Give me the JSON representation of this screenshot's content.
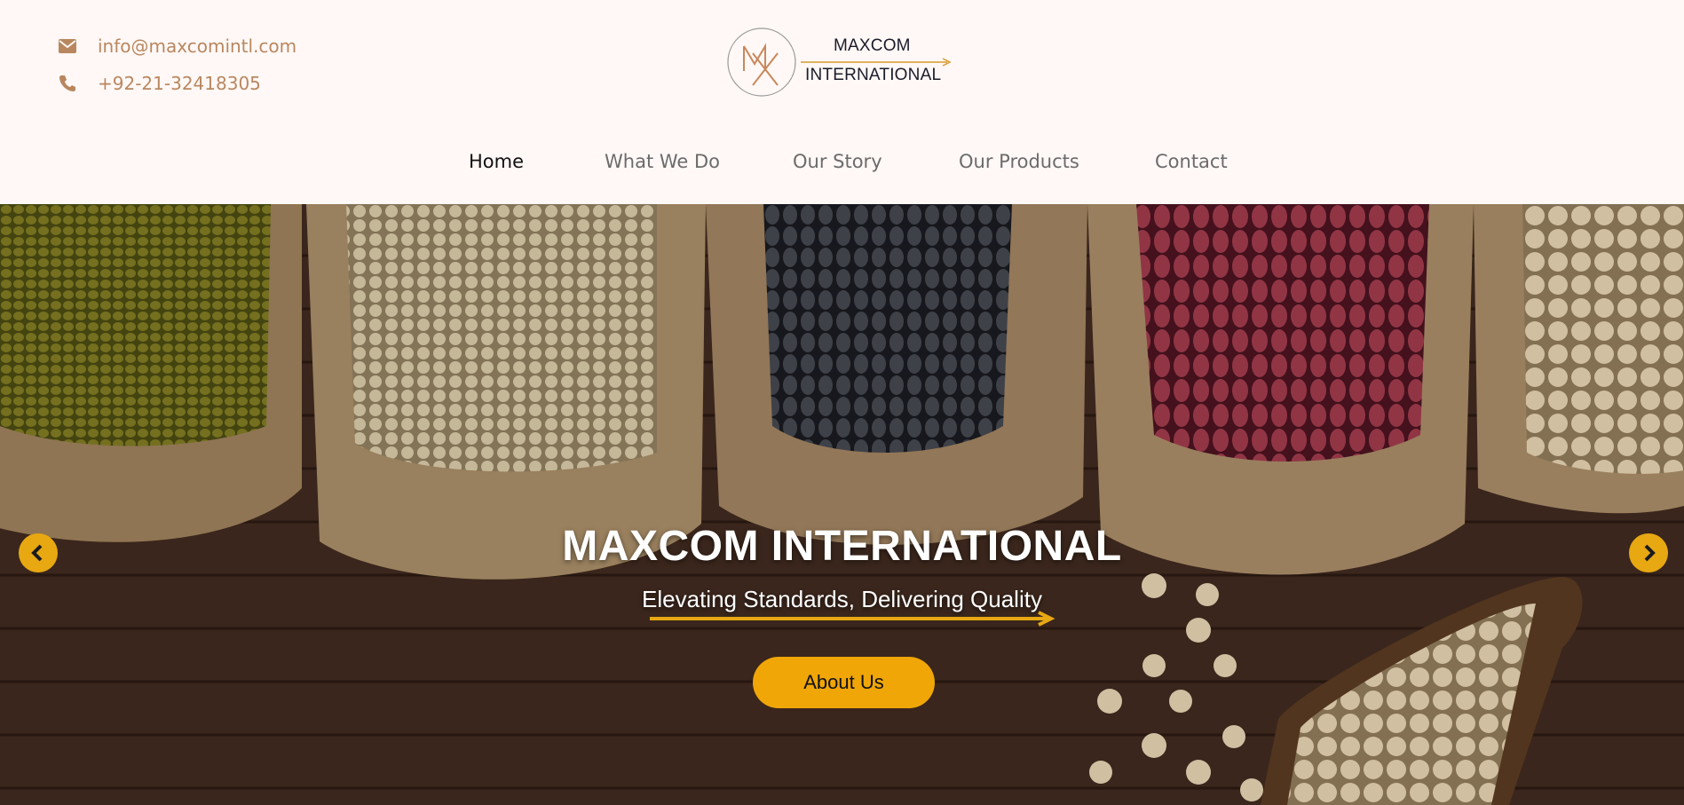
{
  "contact": {
    "email": "info@maxcomintl.com",
    "phone": "+92-21-32418305",
    "email_icon": "envelope-icon",
    "phone_icon": "phone-icon"
  },
  "logo": {
    "line1": "MAXCOM",
    "line2": "INTERNATIONAL",
    "monogram": "MX"
  },
  "nav": {
    "items": [
      {
        "label": "Home",
        "active": true
      },
      {
        "label": "What We Do",
        "active": false
      },
      {
        "label": "Our Story",
        "active": false
      },
      {
        "label": "Our Products",
        "active": false
      },
      {
        "label": "Contact",
        "active": false
      }
    ]
  },
  "hero": {
    "title": "MAXCOM INTERNATIONAL",
    "subtitle": "Elevating Standards, Delivering Quality",
    "button_label": "About Us",
    "prev_icon": "chevron-left-icon",
    "next_icon": "chevron-right-icon"
  },
  "colors": {
    "accent": "#f0a607",
    "contact_text": "#b9875f",
    "header_bg": "#fff8f6"
  }
}
